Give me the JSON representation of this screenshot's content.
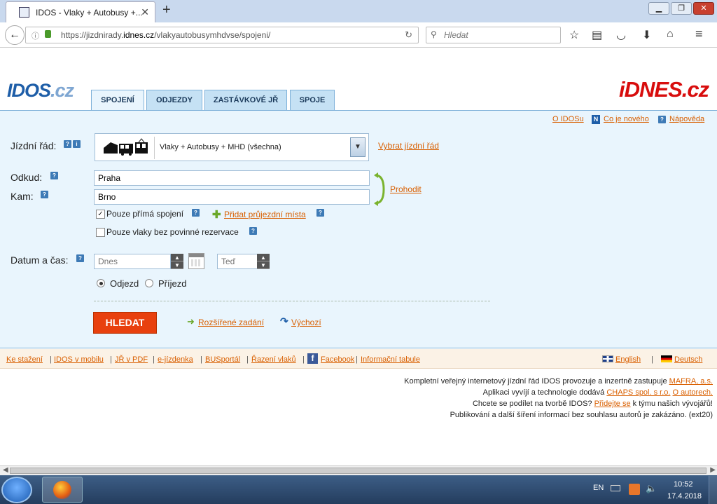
{
  "browser": {
    "tab_title": "IDOS - Vlaky + Autobusy +...",
    "url_prefix": "https://jizdnirady.",
    "url_domain": "idnes.cz",
    "url_path": "/vlakyautobusymhdvse/spojeni/",
    "search_placeholder": "Hledat"
  },
  "header": {
    "logo_left": "IDOS",
    "logo_left_suffix": ".cz",
    "logo_right": "iDNES.cz",
    "tabs": [
      "SPOJENÍ",
      "ODJEZDY",
      "ZASTÁVKOVÉ JŘ",
      "SPOJE"
    ]
  },
  "toplinks": {
    "about": "O IDOSu",
    "news": "Co je nového",
    "help": "Nápověda"
  },
  "form": {
    "timetable_label": "Jízdní řád:",
    "timetable_value": "Vlaky + Autobusy + MHD (všechna)",
    "choose_timetable": "Vybrat jízdní řád",
    "from_label": "Odkud:",
    "from_value": "Praha",
    "to_label": "Kam:",
    "to_value": "Brno",
    "swap": "Prohodit",
    "direct_only": "Pouze přímá spojení",
    "direct_only_checked": true,
    "add_via": "Přidat průjezdní místa",
    "no_reservation": "Pouze vlaky bez povinné rezervace",
    "no_reservation_checked": false,
    "datetime_label": "Datum a čas:",
    "date_placeholder": "Dnes",
    "time_placeholder": "Teď",
    "departure": "Odjezd",
    "arrival": "Příjezd",
    "selected_mode": "Odjezd",
    "search_button": "HLEDAT",
    "advanced": "Rozšířené zadání",
    "default": "Výchozí"
  },
  "footer_links": [
    "Ke stažení",
    "IDOS v mobilu",
    "JŘ v PDF",
    "e-jízdenka",
    "BUSportál",
    "Řazení vlaků",
    "Facebook",
    "Informační tabule"
  ],
  "languages": [
    "English",
    "Deutsch"
  ],
  "info": {
    "line1": "Kompletní veřejný internetový jízdní řád IDOS provozuje a inzertně zastupuje",
    "line1_link": "MAFRA, a.s.",
    "line2": "Aplikaci vyvíjí a technologie dodává",
    "line2_link": "CHAPS spol. s r.o.",
    "line2_link2": "O autorech.",
    "line3_pre": "Chcete se podílet na tvorbě IDOS?",
    "line3_link": "Přidejte se",
    "line3_post": "k týmu našich vývojářů!",
    "line4": "Publikování a další šíření informací bez souhlasu autorů je zakázáno. (ext20)"
  },
  "taskbar": {
    "lang": "EN",
    "time": "10:52",
    "date": "17.4.2018"
  },
  "colors": {
    "accent": "#d95f00",
    "panel": "#e9f5fd",
    "button": "#e8400e",
    "logo_blue": "#1e5ea8",
    "logo_red": "#d80d0d"
  }
}
